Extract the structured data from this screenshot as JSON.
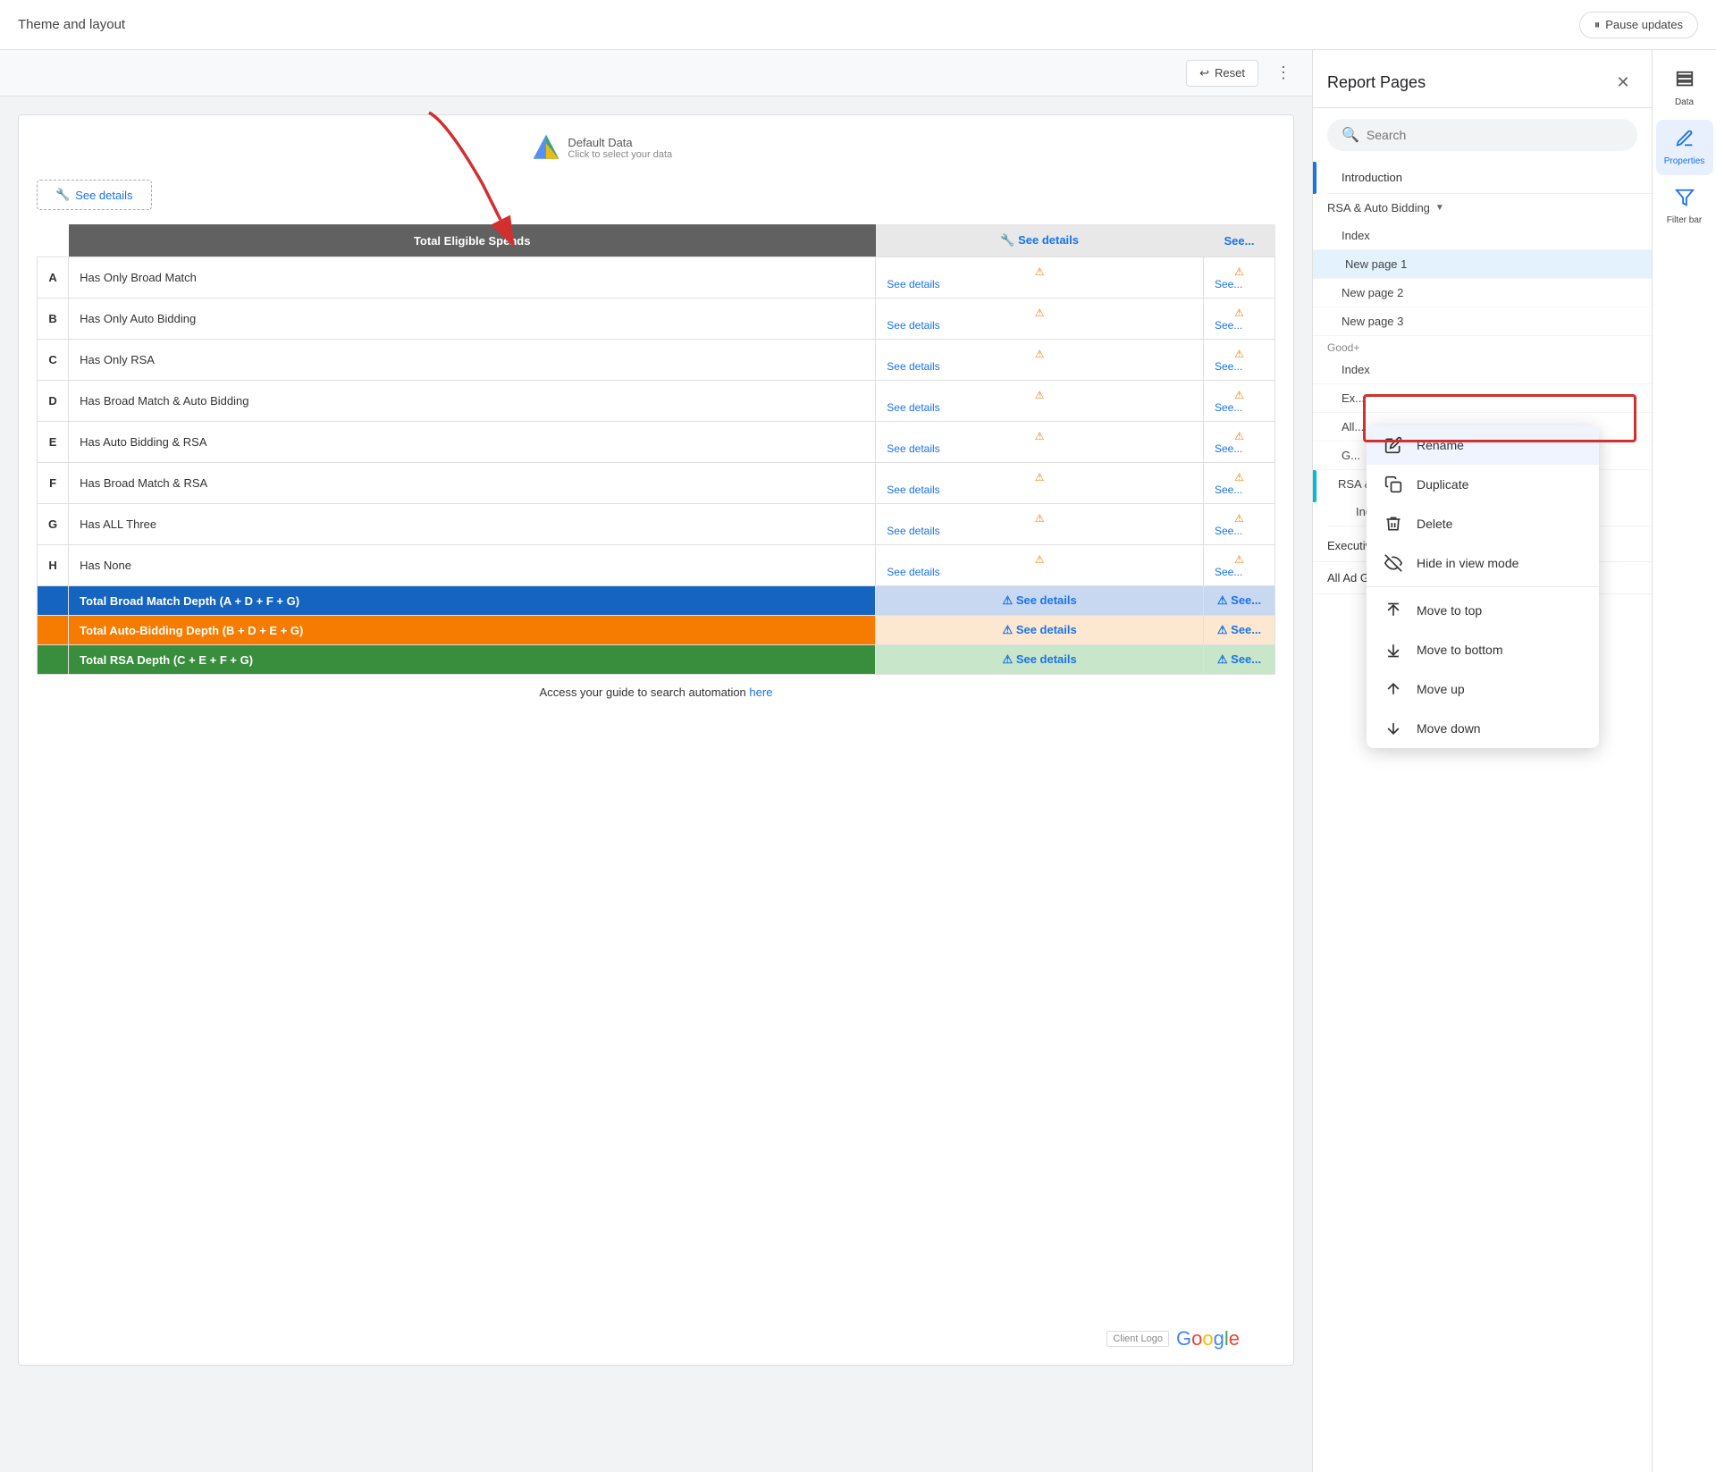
{
  "topbar": {
    "title": "Theme and layout",
    "pause_btn": "Pause updates"
  },
  "toolbar": {
    "reset_label": "Reset"
  },
  "canvas": {
    "default_data": "Default Data",
    "click_text": "Click to select your data",
    "see_details": "See details",
    "table": {
      "header1": "Total Eligible Spends",
      "rows": [
        {
          "letter": "A",
          "label": "Has Only Broad Match"
        },
        {
          "letter": "B",
          "label": "Has Only Auto Bidding"
        },
        {
          "letter": "C",
          "label": "Has Only RSA"
        },
        {
          "letter": "D",
          "label": "Has Broad Match & Auto Bidding"
        },
        {
          "letter": "E",
          "label": "Has Auto Bidding & RSA"
        },
        {
          "letter": "F",
          "label": "Has Broad Match & RSA"
        },
        {
          "letter": "G",
          "label": "Has ALL Three"
        },
        {
          "letter": "H",
          "label": "Has None"
        }
      ],
      "total_rows": [
        {
          "label": "Total Broad Match Depth (A + D + F + G)",
          "color": "blue"
        },
        {
          "label": "Total Auto-Bidding Depth (B + D + E + G)",
          "color": "orange"
        },
        {
          "label": "Total RSA Depth (C + E + F + G)",
          "color": "green"
        }
      ]
    },
    "access_text": "Access your guide to search automation",
    "here_link": "here"
  },
  "report_pages": {
    "title": "Report Pages",
    "search_placeholder": "Search",
    "pages": [
      {
        "label": "Introduction",
        "type": "top",
        "active": false
      },
      {
        "label": "RSA & Auto Bidding",
        "type": "group",
        "expanded": true
      },
      {
        "label": "Index",
        "type": "sub"
      },
      {
        "label": "New page 1",
        "type": "sub-highlighted"
      },
      {
        "label": "New page 2",
        "type": "sub"
      },
      {
        "label": "New page 3",
        "type": "sub"
      },
      {
        "label": "Good+",
        "type": "section"
      },
      {
        "label": "Index",
        "type": "sub2"
      },
      {
        "label": "Executive Summary (copy)",
        "type": "sub2"
      },
      {
        "label": "All Ad Group Detail (copy)",
        "type": "sub2"
      },
      {
        "label": "Good+ (copy)",
        "type": "sub2"
      },
      {
        "label": "RSA & Auto Bidding (copy)",
        "type": "teal-group"
      },
      {
        "label": "Index",
        "type": "sub3"
      },
      {
        "label": "Executive Summary",
        "type": "bottom"
      },
      {
        "label": "All Ad Group Detail",
        "type": "bottom"
      }
    ]
  },
  "context_menu": {
    "items": [
      {
        "icon": "✏️",
        "label": "Rename",
        "active": true
      },
      {
        "icon": "📋",
        "label": "Duplicate"
      },
      {
        "icon": "🗑️",
        "label": "Delete"
      },
      {
        "icon": "🚫",
        "label": "Hide in view mode"
      },
      {
        "icon": "⬆",
        "label": "Move to top"
      },
      {
        "icon": "⬇",
        "label": "Move to bottom"
      },
      {
        "icon": "↑",
        "label": "Move up"
      },
      {
        "icon": "↓",
        "label": "Move down"
      }
    ]
  },
  "right_panel": {
    "data_label": "Data",
    "properties_label": "Properties",
    "filter_label": "Filter bar"
  }
}
